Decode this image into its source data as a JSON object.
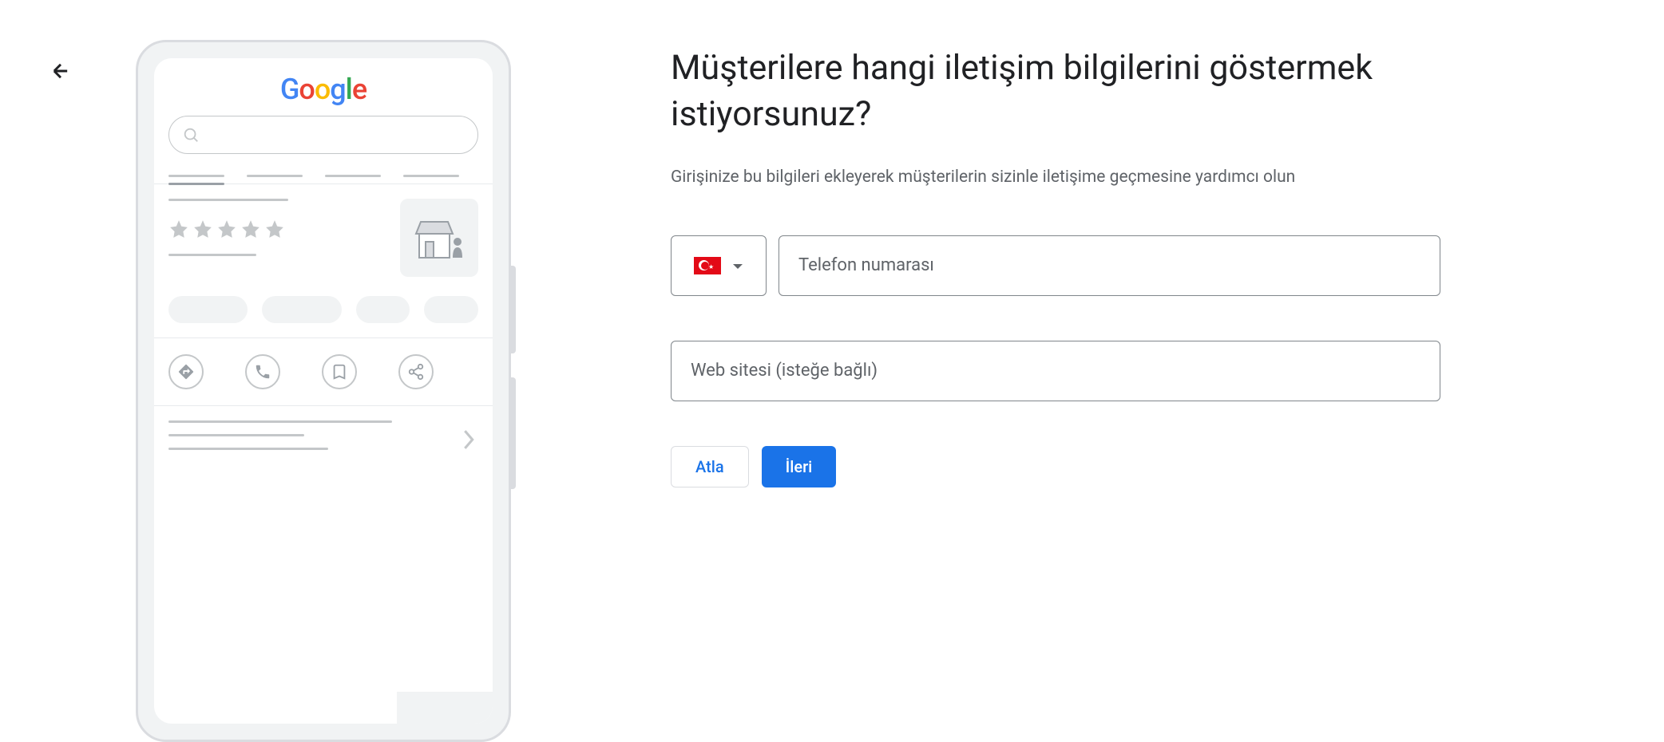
{
  "form": {
    "heading": "Müşterilere hangi iletişim bilgilerini göstermek istiyorsunuz?",
    "description": "Girişinize bu bilgileri ekleyerek müşterilerin sizinle iletişime geçmesine yardımcı olun",
    "country_code": "TR",
    "phone_placeholder": "Telefon numarası",
    "website_placeholder": "Web sitesi (isteğe bağlı)",
    "skip_label": "Atla",
    "next_label": "İleri"
  },
  "preview": {
    "logo": "Google"
  }
}
